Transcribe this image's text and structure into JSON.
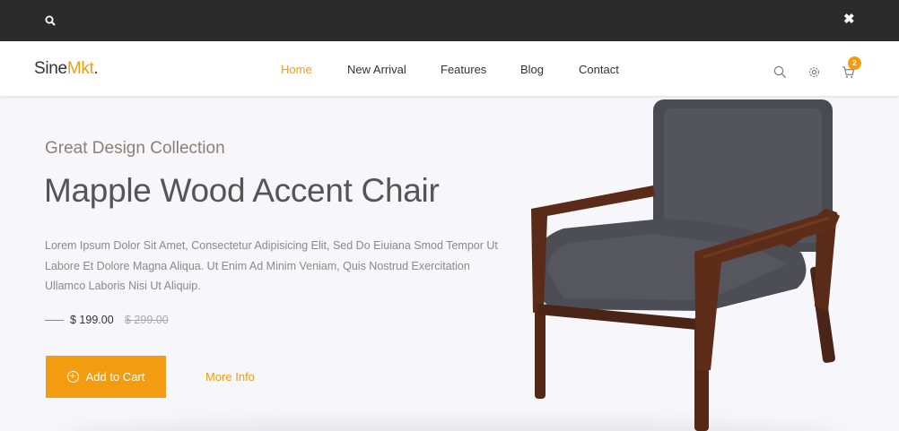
{
  "topbar": {
    "search_icon": "search-icon",
    "close_glyph": "✖"
  },
  "header": {
    "logo_main": "Sine",
    "logo_accent": "Mkt",
    "logo_dot": ".",
    "nav": [
      {
        "label": "Home",
        "active": true
      },
      {
        "label": "New Arrival",
        "active": false
      },
      {
        "label": "Features",
        "active": false
      },
      {
        "label": "Blog",
        "active": false
      },
      {
        "label": "Contact",
        "active": false
      }
    ],
    "icons": [
      "search-icon",
      "gear-icon",
      "cart-icon"
    ],
    "cart_count": "2"
  },
  "hero": {
    "subtitle": "Great Design Collection",
    "title": "Mapple Wood Accent Chair",
    "description": "Lorem Ipsum Dolor Sit Amet, Consectetur Adipisicing Elit, Sed Do Eiuiana Smod Tempor Ut Labore Et Dolore Magna Aliqua. Ut Enim Ad Minim Veniam, Quis Nostrud Exercitation Ullamco Laboris Nisi Ut Aliquip.",
    "price": "$ 199.00",
    "old_price": "$ 299.00",
    "cart_button": "Add to Cart",
    "more_link": "More Info"
  },
  "colors": {
    "accent": "#f39c12",
    "topbar": "#2b2b2b",
    "background": "#f6f6fb"
  }
}
